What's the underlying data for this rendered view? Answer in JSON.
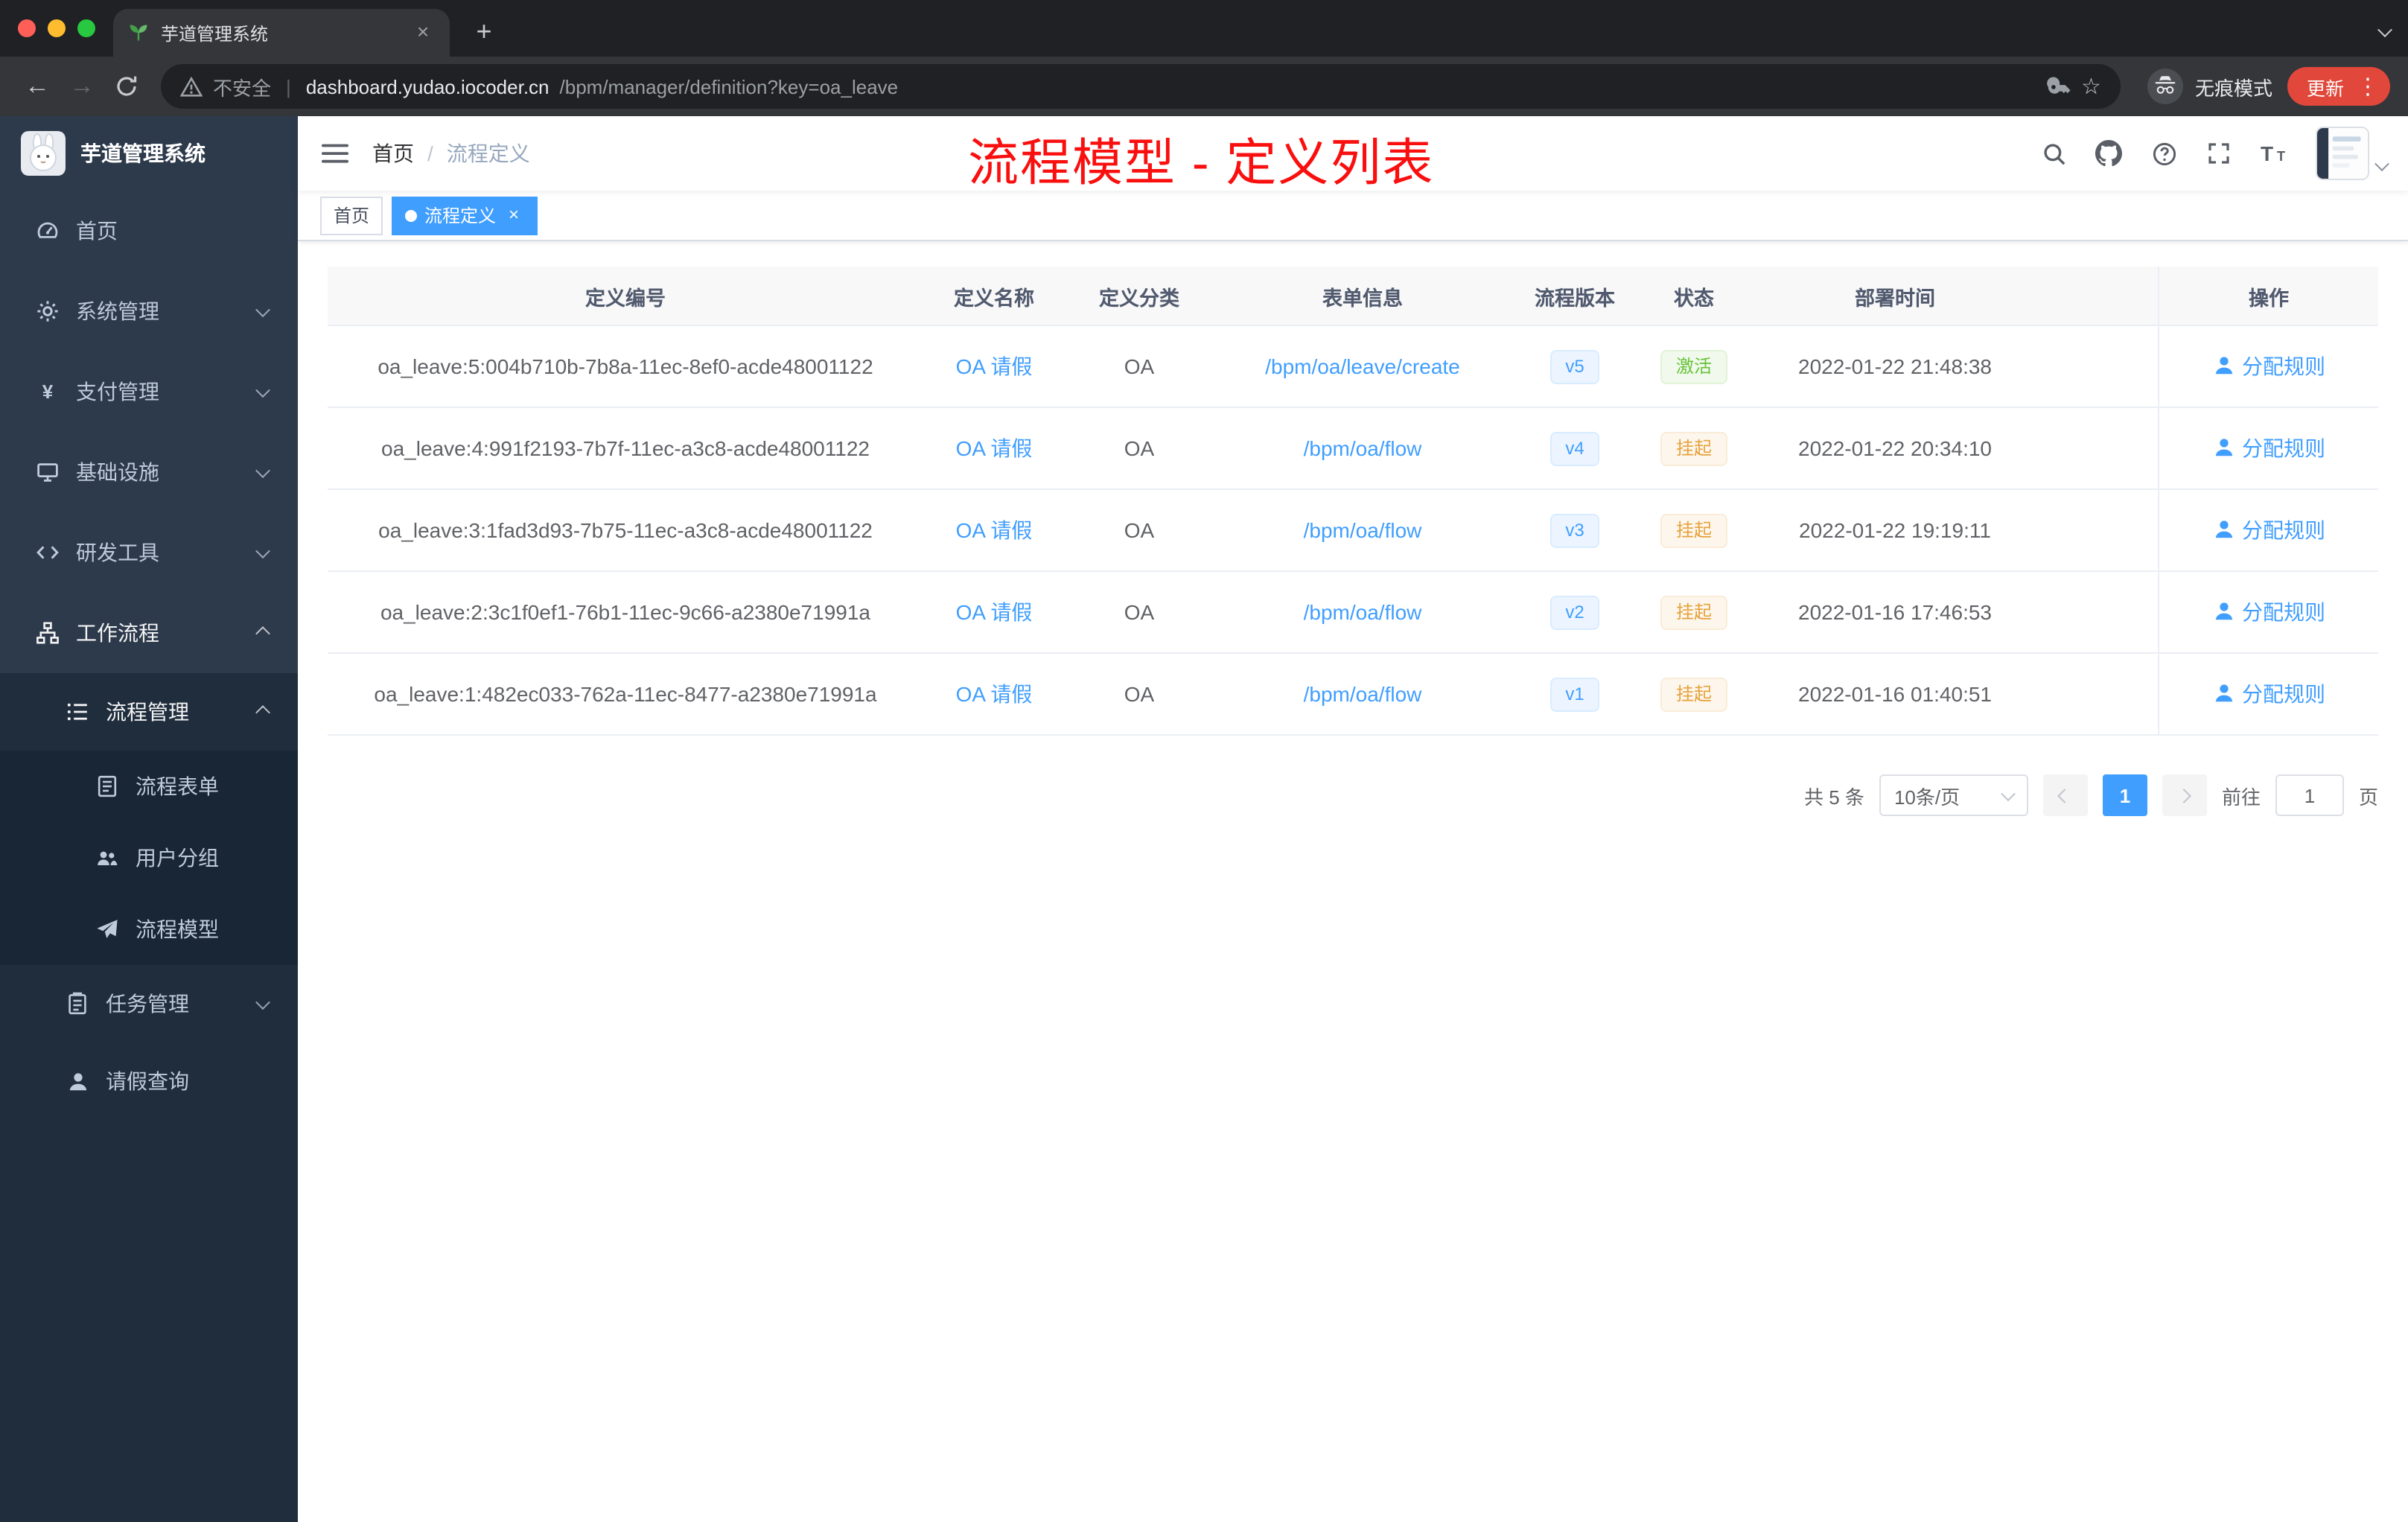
{
  "browser": {
    "tab": {
      "title": "芋道管理系统"
    },
    "address": {
      "security_label": "不安全",
      "host": "dashboard.yudao.iocoder.cn",
      "path": "/bpm/manager/definition?key=oa_leave"
    },
    "incognito_label": "无痕模式",
    "update_label": "更新"
  },
  "sidebar": {
    "app_title": "芋道管理系统",
    "items": [
      {
        "key": "home",
        "label": "首页",
        "icon": "dashboard-icon",
        "level": 1
      },
      {
        "key": "system",
        "label": "系统管理",
        "icon": "gear-icon",
        "level": 1,
        "expand": "down"
      },
      {
        "key": "payment",
        "label": "支付管理",
        "icon": "yen-icon",
        "level": 1,
        "expand": "down"
      },
      {
        "key": "infrastructure",
        "label": "基础设施",
        "icon": "monitor-icon",
        "level": 1,
        "expand": "down"
      },
      {
        "key": "dev-tools",
        "label": "研发工具",
        "icon": "code-icon",
        "level": 1,
        "expand": "down"
      },
      {
        "key": "workflow",
        "label": "工作流程",
        "icon": "workflow-icon",
        "level": 1,
        "expand": "up",
        "active": true
      },
      {
        "key": "process-management",
        "label": "流程管理",
        "icon": "list-icon",
        "level": 2,
        "expand": "up",
        "active": true
      },
      {
        "key": "process-form",
        "label": "流程表单",
        "icon": "form-icon",
        "level": 3
      },
      {
        "key": "user-group",
        "label": "用户分组",
        "icon": "group-icon",
        "level": 3
      },
      {
        "key": "process-model",
        "label": "流程模型",
        "icon": "send-icon",
        "level": 3
      },
      {
        "key": "task-management",
        "label": "任务管理",
        "icon": "task-icon",
        "level": 2,
        "expand": "down"
      },
      {
        "key": "leave-query",
        "label": "请假查询",
        "icon": "user-icon",
        "level": 2
      }
    ]
  },
  "header": {
    "breadcrumb": [
      "首页",
      "流程定义"
    ],
    "annotation": "流程模型 - 定义列表"
  },
  "tags": [
    {
      "label": "首页",
      "active": false,
      "closable": false
    },
    {
      "label": "流程定义",
      "active": true,
      "closable": true
    }
  ],
  "table": {
    "columns": [
      "定义编号",
      "定义名称",
      "定义分类",
      "表单信息",
      "流程版本",
      "状态",
      "部署时间",
      "操作"
    ],
    "rows": [
      {
        "id": "oa_leave:5:004b710b-7b8a-11ec-8ef0-acde48001122",
        "name": "OA 请假",
        "category": "OA",
        "form": "/bpm/oa/leave/create",
        "version": "v5",
        "status": "激活",
        "status_type": "success",
        "time": "2022-01-22 21:48:38",
        "action": "分配规则"
      },
      {
        "id": "oa_leave:4:991f2193-7b7f-11ec-a3c8-acde48001122",
        "name": "OA 请假",
        "category": "OA",
        "form": "/bpm/oa/flow",
        "version": "v4",
        "status": "挂起",
        "status_type": "warning",
        "time": "2022-01-22 20:34:10",
        "action": "分配规则"
      },
      {
        "id": "oa_leave:3:1fad3d93-7b75-11ec-a3c8-acde48001122",
        "name": "OA 请假",
        "category": "OA",
        "form": "/bpm/oa/flow",
        "version": "v3",
        "status": "挂起",
        "status_type": "warning",
        "time": "2022-01-22 19:19:11",
        "action": "分配规则"
      },
      {
        "id": "oa_leave:2:3c1f0ef1-76b1-11ec-9c66-a2380e71991a",
        "name": "OA 请假",
        "category": "OA",
        "form": "/bpm/oa/flow",
        "version": "v2",
        "status": "挂起",
        "status_type": "warning",
        "time": "2022-01-16 17:46:53",
        "action": "分配规则"
      },
      {
        "id": "oa_leave:1:482ec033-762a-11ec-8477-a2380e71991a",
        "name": "OA 请假",
        "category": "OA",
        "form": "/bpm/oa/flow",
        "version": "v1",
        "status": "挂起",
        "status_type": "warning",
        "time": "2022-01-16 01:40:51",
        "action": "分配规则"
      }
    ]
  },
  "pagination": {
    "total": "共 5 条",
    "page_size": "10条/页",
    "current_page": "1",
    "goto_label": "前往",
    "goto_value": "1",
    "page_unit": "页"
  },
  "colors": {
    "accent": "#409eff",
    "success": "#67c23a",
    "warning": "#e6a23c",
    "annotation_red": "#fa0f0f",
    "sidebar_bg": "#2d3a4b",
    "submenu_bg": "#1f2d3d"
  }
}
